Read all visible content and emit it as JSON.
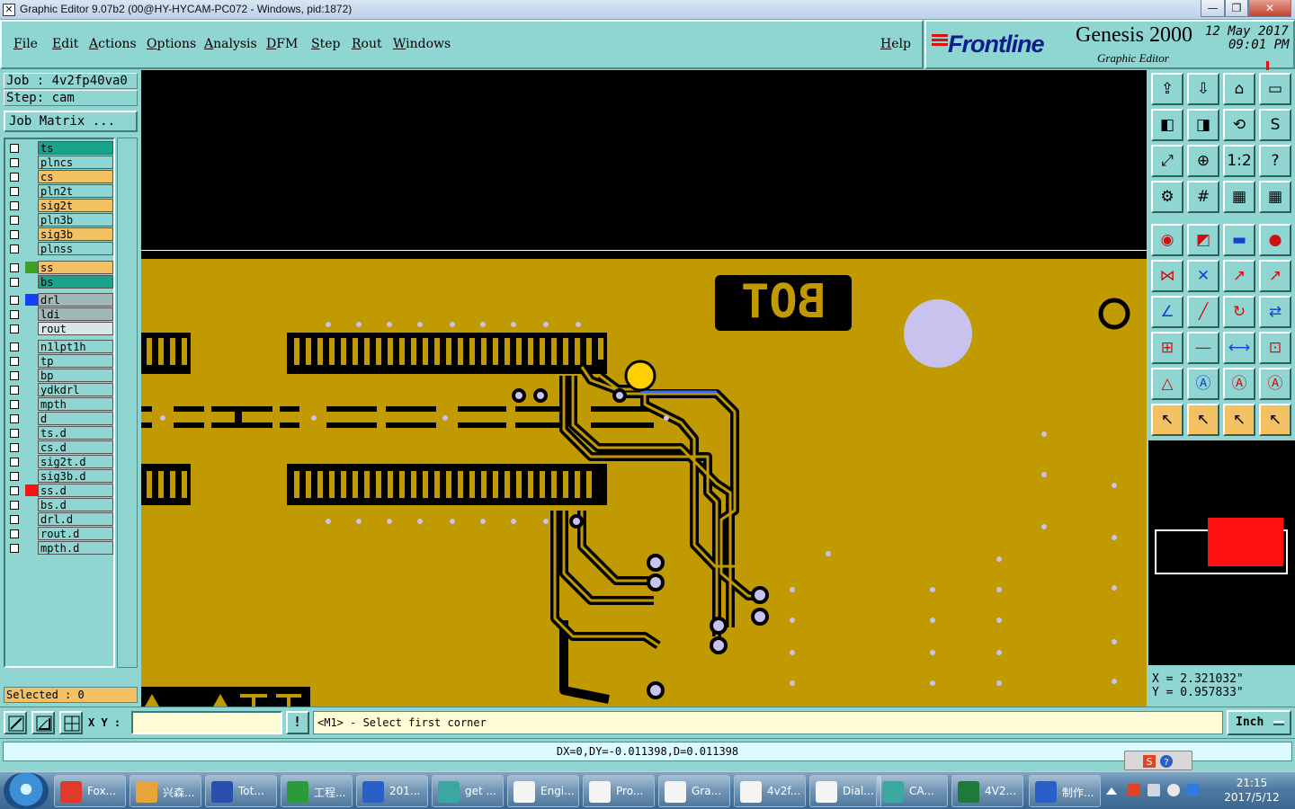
{
  "window": {
    "title": "Graphic Editor 9.07b2 (00@HY-HYCAM-PC072 - Windows, pid:1872)",
    "controls": [
      "—",
      "❐",
      "✕"
    ]
  },
  "menu": {
    "items": [
      "File",
      "Edit",
      "Actions",
      "Options",
      "Analysis",
      "DFM",
      "Step",
      "Rout",
      "Windows"
    ],
    "help": "Help"
  },
  "brand": {
    "logo": "Frontline",
    "product": "Genesis 2000",
    "subtitle": "Graphic Editor",
    "date": "12 May 2017",
    "time": "09:01 PM",
    "colors": {
      "logo": "#0c1e8a",
      "accent": "#dd1111"
    }
  },
  "job": {
    "job_line": "Job : 4v2fp40va0",
    "step_line": "Step: cam",
    "job_matrix_label": "Job Matrix ..."
  },
  "layers": [
    {
      "name": "ts",
      "color": "#19a38a",
      "swatch": ""
    },
    {
      "name": "plncs",
      "color": "#8fd6d2",
      "swatch": ""
    },
    {
      "name": "cs",
      "color": "#f4c064",
      "swatch": ""
    },
    {
      "name": "pln2t",
      "color": "#8fd6d2",
      "swatch": ""
    },
    {
      "name": "sig2t",
      "color": "#f4c064",
      "swatch": ""
    },
    {
      "name": "pln3b",
      "color": "#8fd6d2",
      "swatch": ""
    },
    {
      "name": "sig3b",
      "color": "#f4c064",
      "swatch": ""
    },
    {
      "name": "plnss",
      "color": "#8fd6d2",
      "swatch": ""
    },
    {
      "name": "ss",
      "color": "#f4c064",
      "swatch": "#3aa01e",
      "active": true
    },
    {
      "name": "bs",
      "color": "#19a38a",
      "swatch": ""
    },
    {
      "name": "drl",
      "color": "#9fb7b5",
      "swatch": "#1340ff"
    },
    {
      "name": "ldi",
      "color": "#9fb7b5",
      "swatch": ""
    },
    {
      "name": "rout",
      "color": "#d9e6e5",
      "swatch": ""
    },
    {
      "name": "n1lpt1h",
      "color": "#8fd6d2",
      "swatch": ""
    },
    {
      "name": "tp",
      "color": "#8fd6d2",
      "swatch": ""
    },
    {
      "name": "bp",
      "color": "#8fd6d2",
      "swatch": ""
    },
    {
      "name": "ydkdrl",
      "color": "#8fd6d2",
      "swatch": ""
    },
    {
      "name": "mpth",
      "color": "#8fd6d2",
      "swatch": ""
    },
    {
      "name": "d",
      "color": "#8fd6d2",
      "swatch": ""
    },
    {
      "name": "ts.d",
      "color": "#8fd6d2",
      "swatch": ""
    },
    {
      "name": "cs.d",
      "color": "#8fd6d2",
      "swatch": ""
    },
    {
      "name": "sig2t.d",
      "color": "#8fd6d2",
      "swatch": ""
    },
    {
      "name": "sig3b.d",
      "color": "#8fd6d2",
      "swatch": ""
    },
    {
      "name": "ss.d",
      "color": "#8fd6d2",
      "swatch": "#ff1010"
    },
    {
      "name": "bs.d",
      "color": "#8fd6d2",
      "swatch": ""
    },
    {
      "name": "drl.d",
      "color": "#8fd6d2",
      "swatch": ""
    },
    {
      "name": "rout.d",
      "color": "#8fd6d2",
      "swatch": ""
    },
    {
      "name": "mpth.d",
      "color": "#8fd6d2",
      "swatch": ""
    }
  ],
  "selection": {
    "label": "Selected : 0"
  },
  "canvas": {
    "silkscreen_text": "BOT",
    "colors": {
      "copper": "#c09a00",
      "background": "#000000",
      "pad": "#c8c2ee",
      "highlight": "#ffd000",
      "trace_highlight": "#3a6cff"
    }
  },
  "toolbox": {
    "icons": [
      "zoom-home-icon",
      "zoom-in-icon",
      "home-icon",
      "fit-window-icon",
      "pan-left-icon",
      "pan-right-icon",
      "undo-view-icon",
      "redraw-icon",
      "zoom-fit-icon",
      "zoom-center-icon",
      "scale-1-2-icon",
      "help-icon",
      "settings-icon",
      "grid-icon",
      "layers-icon",
      "layers-active-icon",
      "add-pad-icon",
      "add-line-icon",
      "ruler-icon",
      "select-pad-icon",
      "connect-icon",
      "snap-icon",
      "move-icon",
      "move-copy-icon",
      "angle-icon",
      "slope-icon",
      "rotate-icon",
      "mirror-icon",
      "net-icon",
      "cut-icon",
      "measure-icon",
      "group-icon",
      "triangle-a-icon",
      "triangle-b-icon",
      "triangle-c-icon",
      "triangle-d-icon",
      "pointer-icon",
      "select-icon",
      "select-rotate-icon",
      "select-move-icon"
    ]
  },
  "coords": {
    "x": "X = 2.321032\"",
    "y": "Y = 0.957833\""
  },
  "command": {
    "xy_label": "X Y :",
    "xy_value": "",
    "exclaim": "!",
    "prompt": "<M1> - Select first corner",
    "unit": "Inch"
  },
  "status": {
    "message": "DX=0,DY=-0.011398,D=0.011398"
  },
  "taskbar": {
    "items": [
      {
        "label": "Fox...",
        "color": "#e03a2a"
      },
      {
        "label": "兴森...",
        "color": "#e8a33a"
      },
      {
        "label": "Tot...",
        "color": "#2a4fb0"
      },
      {
        "label": "工程...",
        "color": "#2a9a3a"
      },
      {
        "label": "201...",
        "color": "#2a5ec8"
      },
      {
        "label": "get ...",
        "color": "#3aa8a0"
      },
      {
        "label": "Engi...",
        "color": "#f4f4f4"
      },
      {
        "label": "Pro...",
        "color": "#f4f4f4"
      },
      {
        "label": "Gra...",
        "color": "#f4f4f4"
      },
      {
        "label": "4v2f...",
        "color": "#f4f4f4"
      },
      {
        "label": "Dial...",
        "color": "#f4f4f4"
      },
      {
        "label": "CA...",
        "color": "#3aa8a0"
      },
      {
        "label": "4V2...",
        "color": "#1e7a3a"
      },
      {
        "label": "制作...",
        "color": "#2a5ec8"
      }
    ],
    "clock_time": "21:15",
    "clock_date": "2017/5/12"
  }
}
